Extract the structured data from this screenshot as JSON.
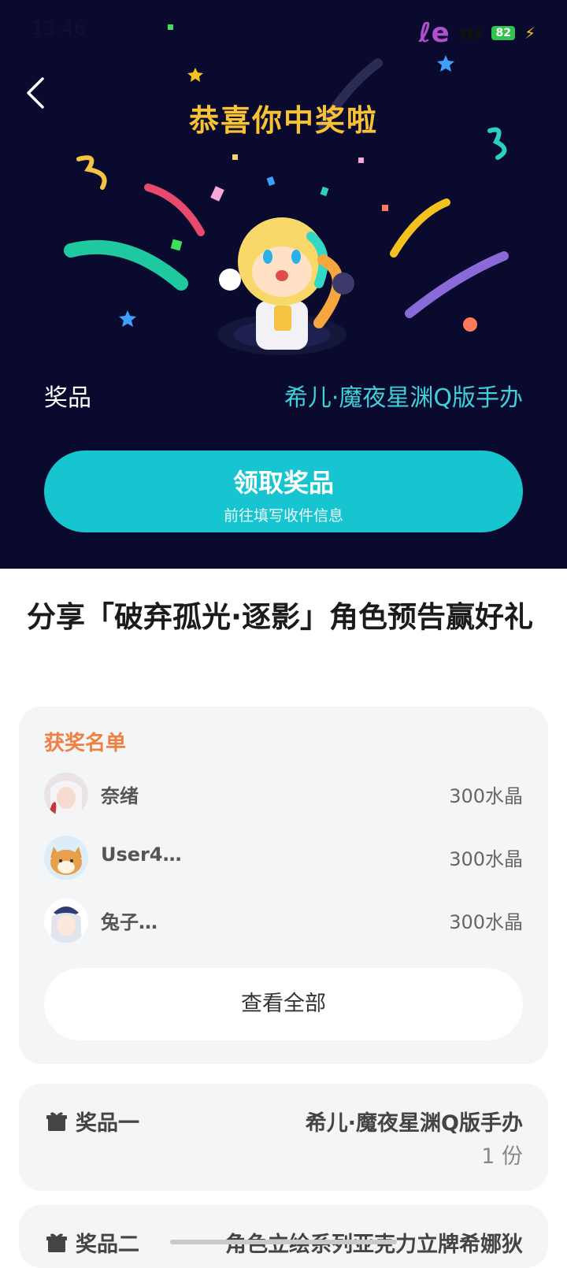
{
  "status_bar": {
    "time": "13:46",
    "battery": "82"
  },
  "hero": {
    "title": "恭喜你中奖啦",
    "prize_label": "奖品",
    "prize_value": "希儿·魔夜星渊Q版手办",
    "claim_button": {
      "label": "领取奖品",
      "sublabel": "前往填写收件信息"
    }
  },
  "event": {
    "title": "分享「破弃孤光·逐影」角色预告赢好礼"
  },
  "winners": {
    "title": "获奖名单",
    "list": [
      {
        "name": "奈绪",
        "prize": "300水晶"
      },
      {
        "name": "User4…",
        "prize": "300水晶"
      },
      {
        "name": "兔子…",
        "prize": "300水晶"
      }
    ],
    "view_all": "查看全部"
  },
  "prizes": [
    {
      "label": "奖品一",
      "value": "希儿·魔夜星渊Q版手办",
      "count": "1 份"
    },
    {
      "label": "奖品二",
      "value": "角色立绘系列亚克力立牌希娜狄"
    }
  ],
  "colors": {
    "hero_bg": "#0a0a2e",
    "accent": "#16c5cf",
    "title_gold": "#f7c233",
    "winner_orange": "#f07f42"
  }
}
